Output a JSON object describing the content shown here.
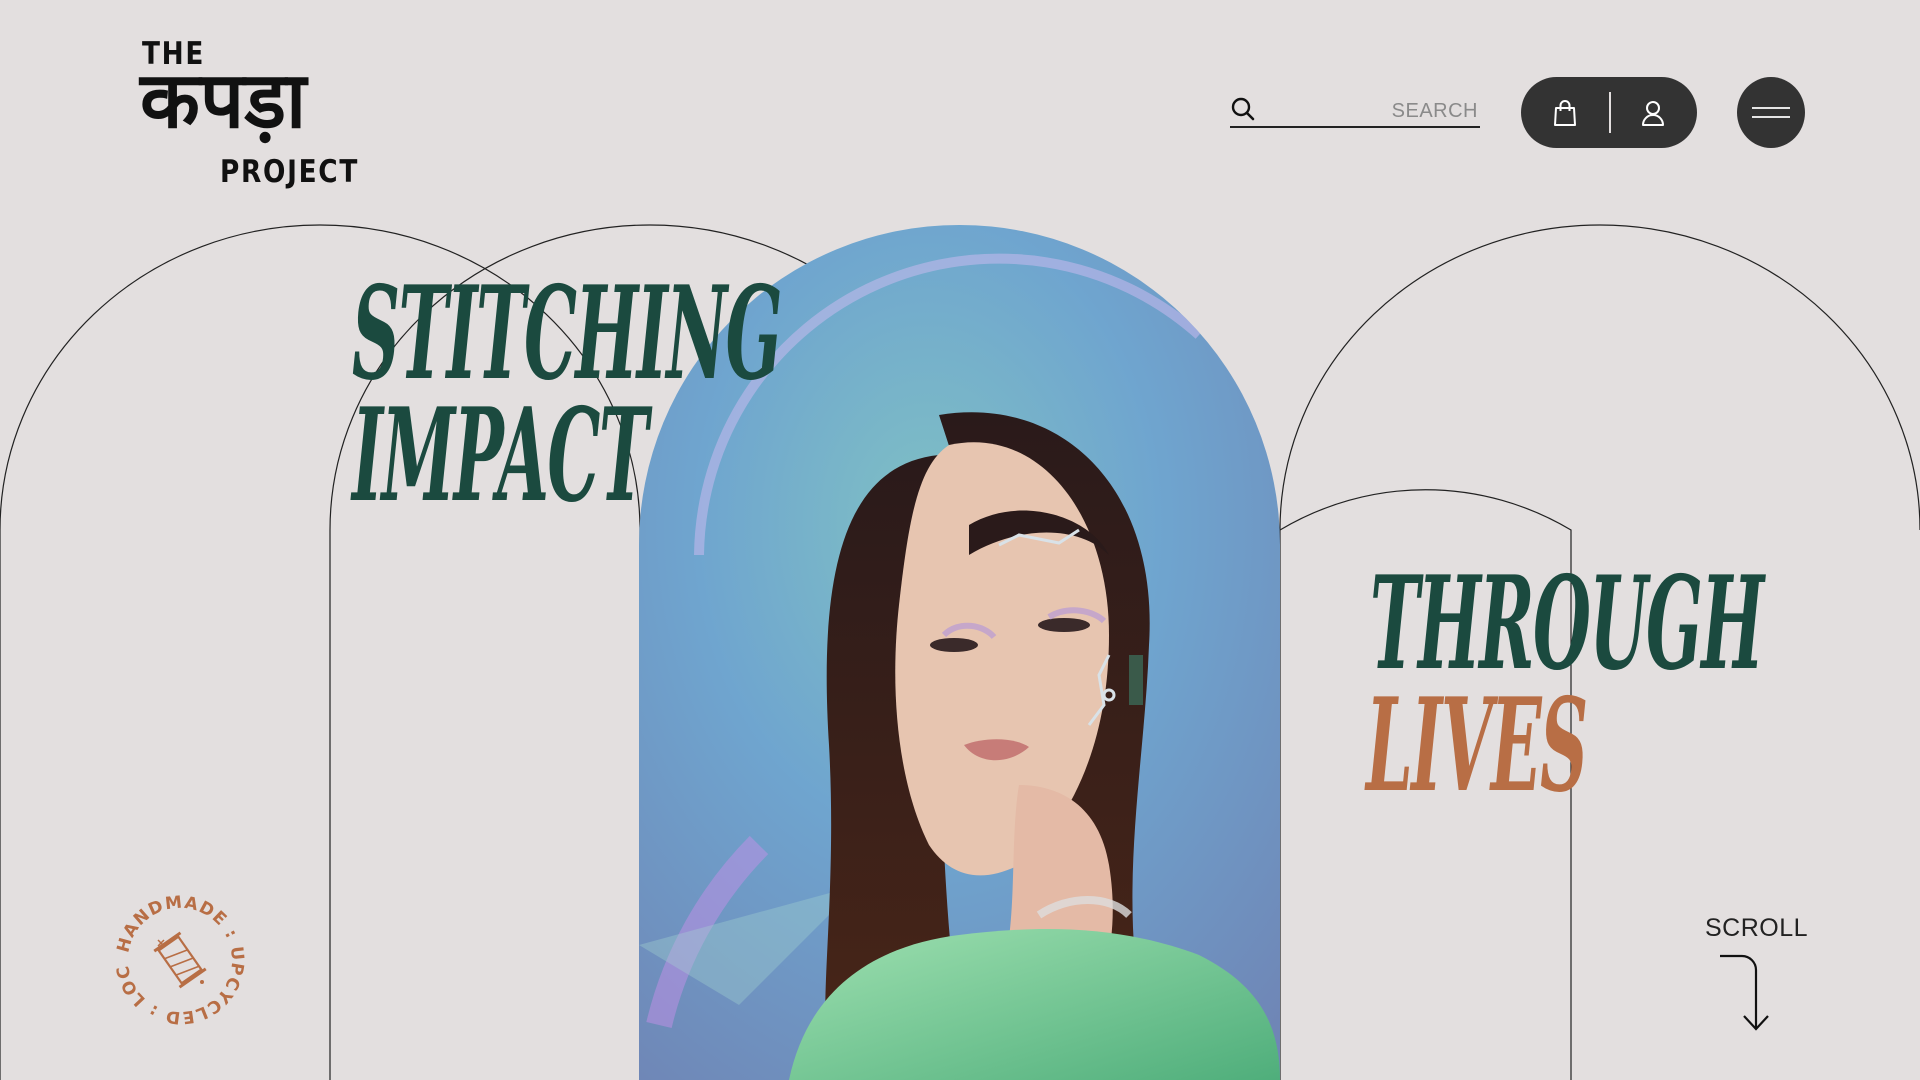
{
  "brand": {
    "logo_top": "THE",
    "logo_middle": "कपड़ा",
    "logo_bottom": "PROJECT"
  },
  "header": {
    "search_placeholder": "SEARCH",
    "cart_icon": "shopping-bag-icon",
    "account_icon": "user-icon",
    "menu_icon": "hamburger-menu-icon"
  },
  "hero": {
    "line1": "STITCHING",
    "line2": "IMPACT",
    "line3": "THROUGH",
    "line4": "LIVES"
  },
  "badge": {
    "text": "HANDMADE : UPCYCLED : LOCAL :",
    "icon": "thread-spool-icon"
  },
  "scroll": {
    "label": "SCROLL"
  },
  "colors": {
    "background": "#e3dfdf",
    "headline_green": "#1b4a3f",
    "accent_rust": "#b86e45",
    "dark_button": "#333333"
  }
}
